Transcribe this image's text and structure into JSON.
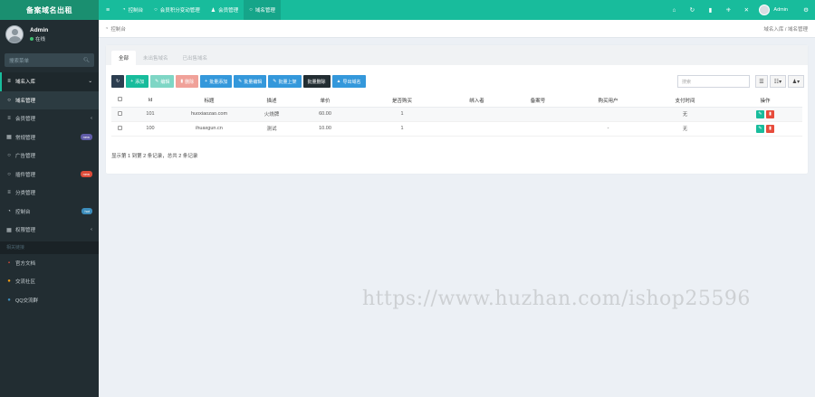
{
  "brand": "备案域名出租",
  "user": {
    "name": "Admin",
    "status": "在线"
  },
  "sidebar": {
    "search_placeholder": "搜索菜单",
    "items": [
      {
        "label": "域名入库",
        "icon": "list-icon",
        "right": "⌄"
      },
      {
        "label": "域名管理",
        "icon": "circle-icon",
        "right": ""
      },
      {
        "label": "会员管理",
        "icon": "list-icon",
        "right": "‹"
      },
      {
        "label": "常规管理",
        "icon": "grid-icon",
        "badge": "new",
        "badge_color": "#605ca8"
      },
      {
        "label": "广告管理",
        "icon": "circle-icon",
        "right": ""
      },
      {
        "label": "插件管理",
        "icon": "circle-icon",
        "badge": "new",
        "badge_color": "#dd4b39"
      },
      {
        "label": "分类管理",
        "icon": "list-icon",
        "right": ""
      },
      {
        "label": "控制台",
        "icon": "dashboard-icon",
        "badge": "hot",
        "badge_color": "#3c8dbc"
      },
      {
        "label": "权限管理",
        "icon": "grid-icon",
        "right": "‹"
      }
    ],
    "section_header": "相关链接",
    "links": [
      {
        "label": "官方文档",
        "icon": "book-icon",
        "color": "#dd4b39"
      },
      {
        "label": "交流社区",
        "icon": "chat-icon",
        "color": "#f39c12"
      },
      {
        "label": "QQ交流群",
        "icon": "qq-icon",
        "color": "#3c8dbc"
      }
    ]
  },
  "topbar": {
    "tabs": [
      {
        "label": "控制台",
        "icon": "dashboard-icon"
      },
      {
        "label": "会员积分变动管理",
        "icon": "circle-icon"
      },
      {
        "label": "会员管理",
        "icon": "user-icon"
      },
      {
        "label": "域名管理",
        "icon": "circle-icon",
        "active": true
      }
    ],
    "admin": "Admin"
  },
  "breadcrumb": {
    "left": "控制台",
    "right": "域名入库 / 域名管理"
  },
  "panel": {
    "tabs": [
      "全部",
      "未出售域名",
      "已出售域名"
    ],
    "toolbar": [
      "添加",
      "编辑",
      "删除",
      "批量添加",
      "批量编辑",
      "批量上架",
      "批量删除",
      "导出域名"
    ],
    "search_placeholder": "搜索"
  },
  "table": {
    "headers": [
      "Id",
      "标题",
      "描述",
      "单价",
      "是否购买",
      "绑入者",
      "备案号",
      "购买用户",
      "支付时间",
      "操作"
    ],
    "rows": [
      [
        "101",
        "huoxiaozao.com",
        "火烧牌",
        "60.00",
        "1",
        "",
        "",
        "",
        "无"
      ],
      [
        "100",
        "ihuaxgun.cn",
        "测试",
        "10.00",
        "1",
        "",
        "",
        "-",
        "无"
      ]
    ]
  },
  "pager": "显示第 1 到第 2 条记录，总共 2 条记录",
  "watermark": "https://www.huzhan.com/ishop25596"
}
